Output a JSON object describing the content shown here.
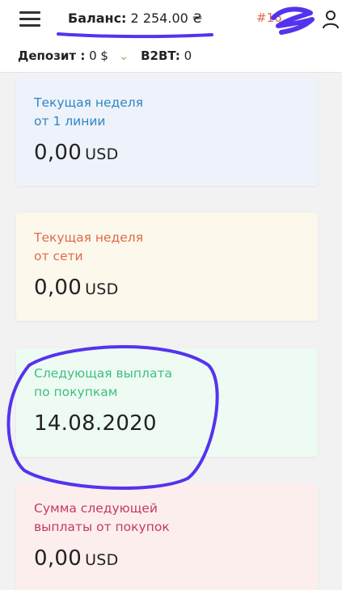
{
  "header": {
    "balance_label": "Баланс:",
    "balance_value": "2 254.00 ₴",
    "order_id": "#16"
  },
  "subbar": {
    "deposit_label": "Депозит :",
    "deposit_value": "0 $",
    "b2bt_label": "B2BT:",
    "b2bt_value": "0"
  },
  "cards": [
    {
      "title_line1": "Текущая неделя",
      "title_line2": "от 1 линии",
      "value": "0,00",
      "unit": "USD",
      "color": "#2c86c5",
      "background": "#eef2fb"
    },
    {
      "title_line1": "Текущая неделя",
      "title_line2": "от сети",
      "value": "0,00",
      "unit": "USD",
      "color": "#e06a4a",
      "background": "#fdf8ec"
    },
    {
      "title_line1": "Следующая выплата",
      "title_line2": "по покупкам",
      "value": "14.08.2020",
      "unit": "",
      "color": "#3fbf7f",
      "background": "#eefbf3"
    },
    {
      "title_line1": "Сумма следующей",
      "title_line2": "выплаты от покупок",
      "value": "0,00",
      "unit": "USD",
      "color": "#c43963",
      "background": "#fdeeee"
    }
  ],
  "icons": {
    "menu": "hamburger-menu-icon",
    "user": "user-icon",
    "dropdown": "chevron-down-icon"
  },
  "annotation_color": "#5533ee"
}
